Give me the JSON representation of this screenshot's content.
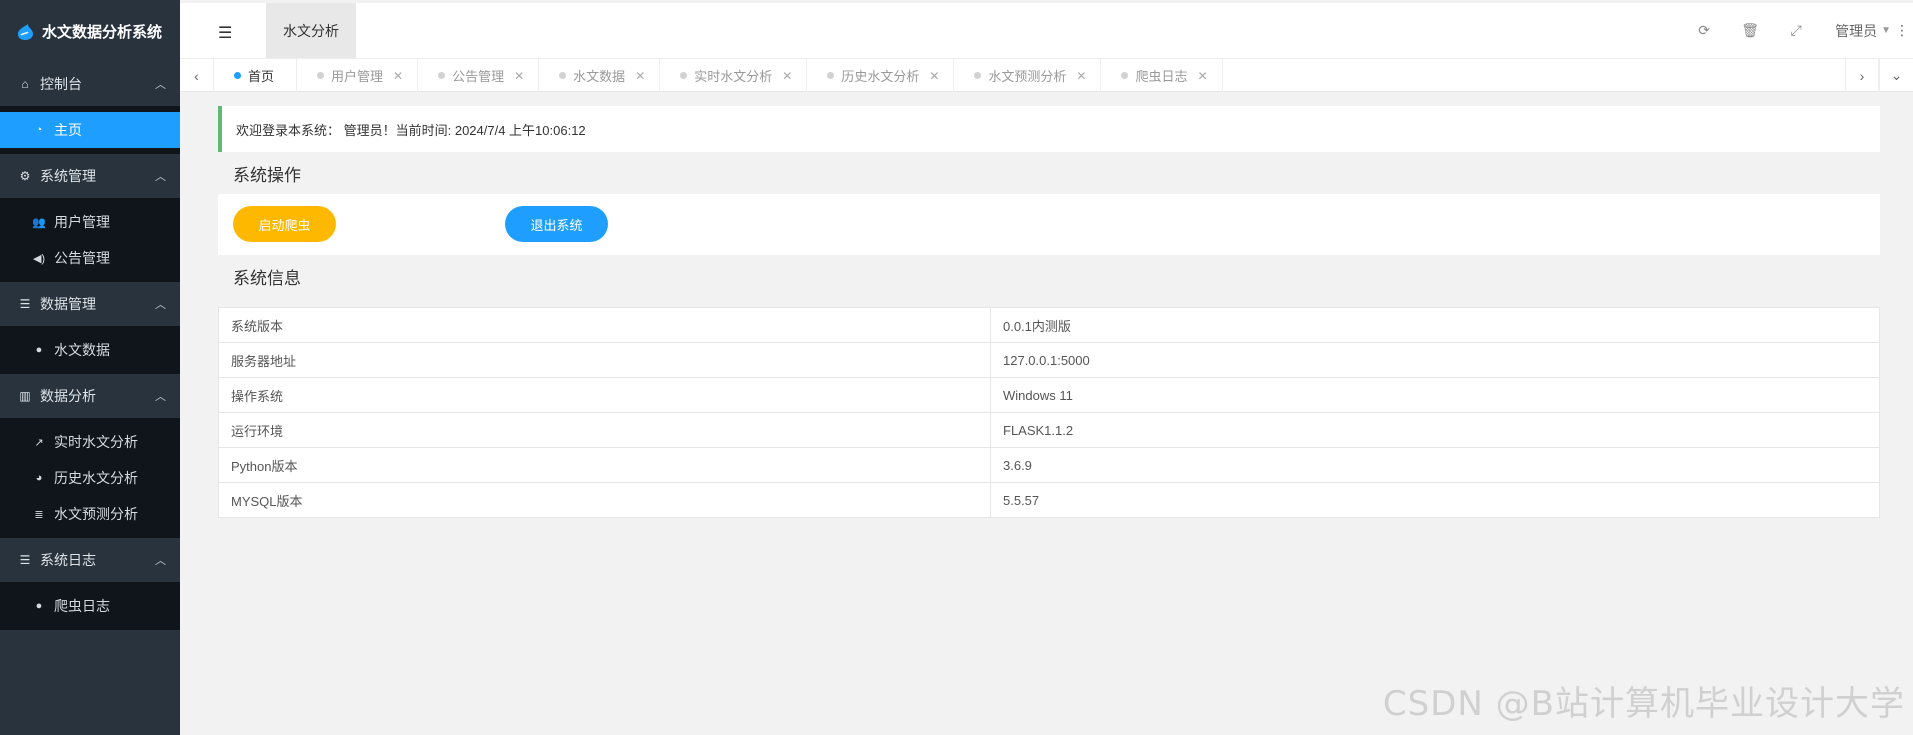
{
  "app": {
    "title": "水文数据分析系统"
  },
  "sidebar": {
    "groups": [
      {
        "label": "控制台",
        "icon": "home-icon",
        "items": [
          {
            "label": "主页",
            "icon": "dashboard-icon",
            "active": true
          }
        ]
      },
      {
        "label": "系统管理",
        "icon": "gears-icon",
        "items": [
          {
            "label": "用户管理",
            "icon": "users-icon"
          },
          {
            "label": "公告管理",
            "icon": "speaker-icon"
          }
        ]
      },
      {
        "label": "数据管理",
        "icon": "list-icon",
        "items": [
          {
            "label": "水文数据",
            "icon": "globe-icon"
          }
        ]
      },
      {
        "label": "数据分析",
        "icon": "bar-chart-icon",
        "items": [
          {
            "label": "实时水文分析",
            "icon": "line-chart-icon"
          },
          {
            "label": "历史水文分析",
            "icon": "pie-chart-icon"
          },
          {
            "label": "水文预测分析",
            "icon": "database-icon"
          }
        ]
      },
      {
        "label": "系统日志",
        "icon": "list-icon",
        "items": [
          {
            "label": "爬虫日志",
            "icon": "globe-icon"
          }
        ]
      }
    ]
  },
  "header": {
    "module_tab": "水文分析",
    "user": "管理员"
  },
  "tabs": [
    {
      "label": "首页",
      "active": true
    },
    {
      "label": "用户管理"
    },
    {
      "label": "公告管理"
    },
    {
      "label": "水文数据"
    },
    {
      "label": "实时水文分析"
    },
    {
      "label": "历史水文分析"
    },
    {
      "label": "水文预测分析"
    },
    {
      "label": "爬虫日志"
    }
  ],
  "main": {
    "welcome": "欢迎登录本系统： 管理员！当前时间: 2024/7/4 上午10:06:12",
    "ops_title": "系统操作",
    "crawl_button": "启动爬虫",
    "exit_button": "退出系统",
    "info_title": "系统信息",
    "info_rows": [
      {
        "key": "系统版本",
        "value": "0.0.1内测版"
      },
      {
        "key": "服务器地址",
        "value": "127.0.0.1:5000"
      },
      {
        "key": "操作系统",
        "value": "Windows 11"
      },
      {
        "key": "运行环境",
        "value": "FLASK1.1.2"
      },
      {
        "key": "Python版本",
        "value": "3.6.9"
      },
      {
        "key": "MYSQL版本",
        "value": "5.5.57"
      }
    ]
  },
  "watermark": "CSDN @B站计算机毕业设计大学",
  "colors": {
    "primary": "#1e9fff",
    "warm": "#ffb800",
    "sidebar": "#28333e",
    "success": "#5fb878"
  }
}
